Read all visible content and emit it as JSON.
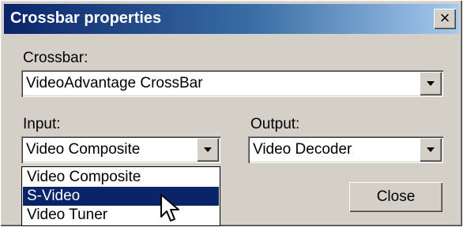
{
  "window": {
    "title": "Crossbar properties",
    "close_glyph": "×"
  },
  "crossbar": {
    "label": "Crossbar:",
    "selected": "VideoAdvantage CrossBar"
  },
  "input": {
    "label": "Input:",
    "selected": "Video Composite",
    "options": [
      "Video Composite",
      "S-Video",
      "Video Tuner"
    ],
    "highlighted_index": 1
  },
  "output": {
    "label": "Output:",
    "selected": "Video Decoder"
  },
  "buttons": {
    "close_label": "Close"
  },
  "colors": {
    "titlebar_start": "#0a246a",
    "titlebar_end": "#a6caf0",
    "selection": "#0a246a",
    "dialog_bg": "#d4d0c8"
  },
  "icons": {
    "cursor": "mouse-pointer-icon",
    "combo_arrow": "chevron-down-icon",
    "close": "close-icon"
  }
}
